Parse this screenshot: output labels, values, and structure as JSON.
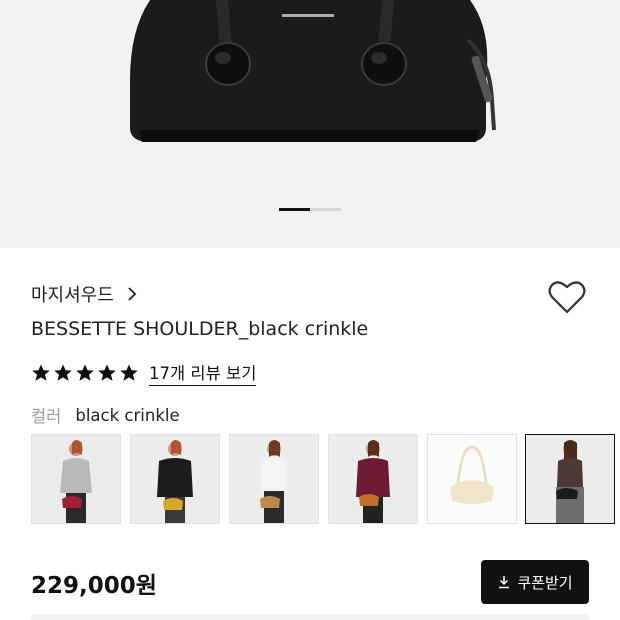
{
  "product_image": {
    "alt_icon": "product-photo"
  },
  "carousel": {
    "total": 2,
    "active": 1
  },
  "brand": {
    "name": "마지셔우드"
  },
  "product": {
    "title": "BESSETTE SHOULDER_black crinkle",
    "rating": 5
  },
  "reviews": {
    "link_label": "17개 리뷰 보기"
  },
  "color": {
    "label": "컬러",
    "value": "black crinkle"
  },
  "variants": [
    {
      "name": "grey-knit",
      "bag": "#a0203a",
      "top": "#b9b9b9",
      "bottom": "#2a2a2a"
    },
    {
      "name": "black-jacket",
      "bag": "#d8a72c",
      "top": "#1c1c1c",
      "bottom": "#3a3a3a"
    },
    {
      "name": "white-tee",
      "bag": "#b98a4a",
      "top": "#f3f3f3",
      "bottom": "#2a2a2a"
    },
    {
      "name": "burgundy-sweater",
      "bag": "#c0702a",
      "top": "#6e1a32",
      "bottom": "#222"
    },
    {
      "name": "cream-bag",
      "bag": "#efe6c9"
    },
    {
      "name": "black-crinkle",
      "bag": "#1a1a1a",
      "top": "#4a3a33",
      "bottom": "#6e6e6e"
    }
  ],
  "price": {
    "text": "229,000원"
  },
  "coupon": {
    "label": "쿠폰받기"
  },
  "colors": {
    "accent": "#111111",
    "muted": "#999999",
    "hero_bg": "#f2f2f2"
  }
}
